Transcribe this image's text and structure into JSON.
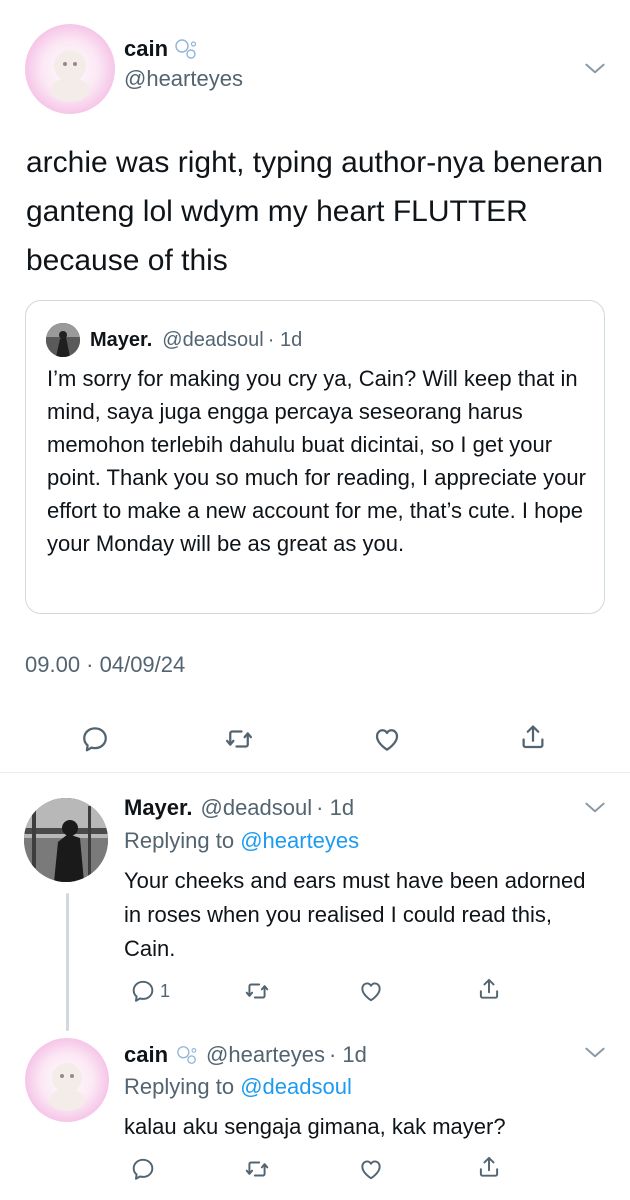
{
  "main_tweet": {
    "name": "cain",
    "handle": "@hearteyes",
    "text": "archie was right, typing author-nya beneran ganteng lol wdym my heart FLUTTER because of this",
    "timestamp": "09.00 · 04/09/24"
  },
  "quote": {
    "name": "Mayer.",
    "handle": "@deadsoul",
    "time": "· 1d",
    "text": "I’m sorry for making you cry ya, Cain? Will keep that in mind, saya juga engga percaya seseorang harus memohon terlebih dahulu buat dicintai, so I get your point. Thank you so much for reading, I appreciate your effort to make a new account for me, that’s cute. I hope your Monday will be as great as you."
  },
  "reply1": {
    "name": "Mayer.",
    "handle": "@deadsoul",
    "time": "· 1d",
    "replying_prefix": "Replying to",
    "replying_to": "@hearteyes",
    "text": "Your cheeks and ears must have been adorned in roses when you realised I could read this, Cain.",
    "reply_count": "1"
  },
  "reply2": {
    "name": "cain",
    "handle": "@hearteyes",
    "time": "· 1d",
    "replying_prefix": "Replying to",
    "replying_to": "@deadsoul",
    "text": "kalau aku sengaja gimana, kak mayer?"
  },
  "icons": [
    "bubbles-icon",
    "chevron-down-icon",
    "reply-icon",
    "retweet-icon",
    "like-icon",
    "share-icon"
  ],
  "colors": {
    "text": "#0f1419",
    "secondary": "#536471",
    "link": "#1d9bf0",
    "border": "#cfd9de"
  }
}
